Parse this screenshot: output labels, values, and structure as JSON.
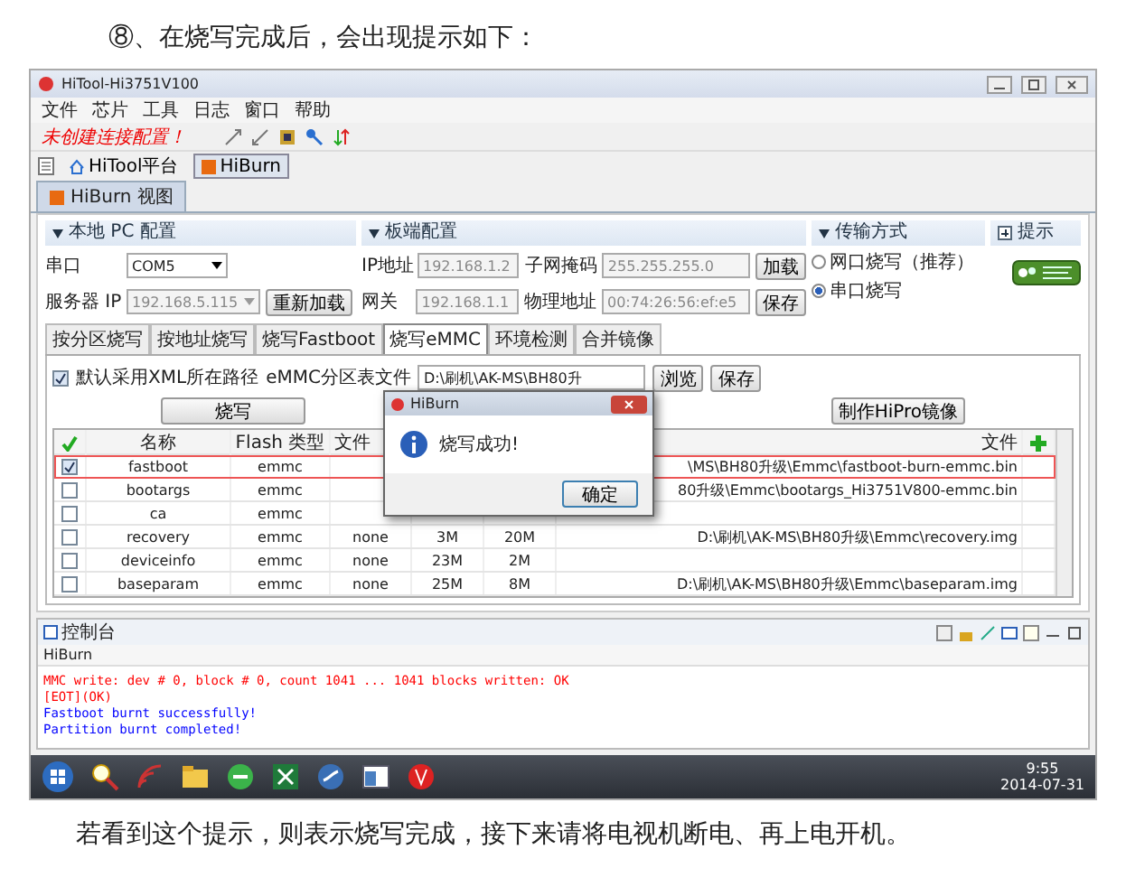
{
  "heading": "⑧、在烧写完成后，会出现提示如下：",
  "window": {
    "title": "HiTool-Hi3751V100"
  },
  "menu": [
    "文件",
    "芯片",
    "工具",
    "日志",
    "窗口",
    "帮助"
  ],
  "toolbar": {
    "status": "未创建连接配置！"
  },
  "perspectives": [
    {
      "label": "HiTool平台",
      "selected": false
    },
    {
      "label": "HiBurn",
      "selected": true
    }
  ],
  "view_tab": "HiBurn 视图",
  "local_pc": {
    "title": "本地 PC 配置",
    "serial_label": "串口",
    "serial_value": "COM5",
    "server_label": "服务器 IP",
    "server_value": "192.168.5.115",
    "reload_button": "重新加载"
  },
  "board": {
    "title": "板端配置",
    "rows": [
      {
        "label": "IP地址",
        "value": "192.168.1.2",
        "label2": "子网掩码",
        "value2": "255.255.255.0",
        "button": "加载"
      },
      {
        "label": "网关",
        "value": "192.168.1.1",
        "label2": "物理地址",
        "value2": "00:74:26:56:ef:e5",
        "button": "保存"
      }
    ]
  },
  "transfer": {
    "title": "传输方式",
    "options": [
      {
        "label": "网口烧写（推荐）",
        "selected": false
      },
      {
        "label": "串口烧写",
        "selected": true
      }
    ]
  },
  "hint": {
    "title": "提示",
    "expanded": false
  },
  "tabs": [
    {
      "label": "按分区烧写",
      "selected": false
    },
    {
      "label": "按地址烧写",
      "selected": false
    },
    {
      "label": "烧写Fastboot",
      "selected": false
    },
    {
      "label": "烧写eMMC",
      "selected": true
    },
    {
      "label": "环境检测",
      "selected": false
    },
    {
      "label": "合并镜像",
      "selected": false
    }
  ],
  "emmc": {
    "xml_path": {
      "label": "默认采用XML所在路径",
      "checked": true
    },
    "file_label": "eMMC分区表文件",
    "file_value": "D:\\刷机\\AK-MS\\BH80升",
    "browse": "浏览",
    "save": "保存",
    "burn": "烧写",
    "make_image": "制作HiPro镜像"
  },
  "table": {
    "columns": {
      "name": "名称",
      "flash": "Flash 类型",
      "fs": "文件",
      "file": "文件"
    },
    "rows": [
      {
        "checked": true,
        "selected": true,
        "name": "fastboot",
        "flash": "emmc",
        "file": "\\MS\\BH80升级\\Emmc\\fastboot-burn-emmc.bin"
      },
      {
        "checked": false,
        "selected": false,
        "name": "bootargs",
        "flash": "emmc",
        "file": "80升级\\Emmc\\bootargs_Hi3751V800-emmc.bin"
      },
      {
        "checked": false,
        "selected": false,
        "name": "ca",
        "flash": "emmc"
      },
      {
        "checked": false,
        "selected": false,
        "name": "recovery",
        "flash": "emmc",
        "fs": "none",
        "start": "3M",
        "size": "20M",
        "file": "D:\\刷机\\AK-MS\\BH80升级\\Emmc\\recovery.img"
      },
      {
        "checked": false,
        "selected": false,
        "name": "deviceinfo",
        "flash": "emmc",
        "fs": "none",
        "start": "23M",
        "size": "2M"
      },
      {
        "checked": false,
        "selected": false,
        "name": "baseparam",
        "flash": "emmc",
        "fs": "none",
        "start": "25M",
        "size": "8M",
        "file": "D:\\刷机\\AK-MS\\BH80升级\\Emmc\\baseparam.img"
      }
    ]
  },
  "dialog": {
    "title": "HiBurn",
    "message": "烧写成功!",
    "button": "确定"
  },
  "console": {
    "tab": "控制台",
    "source": "HiBurn",
    "lines": [
      {
        "text": "MMC write: dev # 0, block # 0, count 1041 ... 1041 blocks written: OK",
        "color": "#ff0000"
      },
      {
        "text": "[EOT](OK)",
        "color": "#ff0000"
      },
      {
        "text": "Fastboot burnt successfully!",
        "color": "#0000ff"
      },
      {
        "text": "Partition burnt completed!",
        "color": "#0000ff"
      }
    ]
  },
  "taskbar": {
    "time": "9:55",
    "date": "2014-07-31"
  },
  "caption": "若看到这个提示，则表示烧写完成，接下来请将电视机断电、再上电开机。"
}
